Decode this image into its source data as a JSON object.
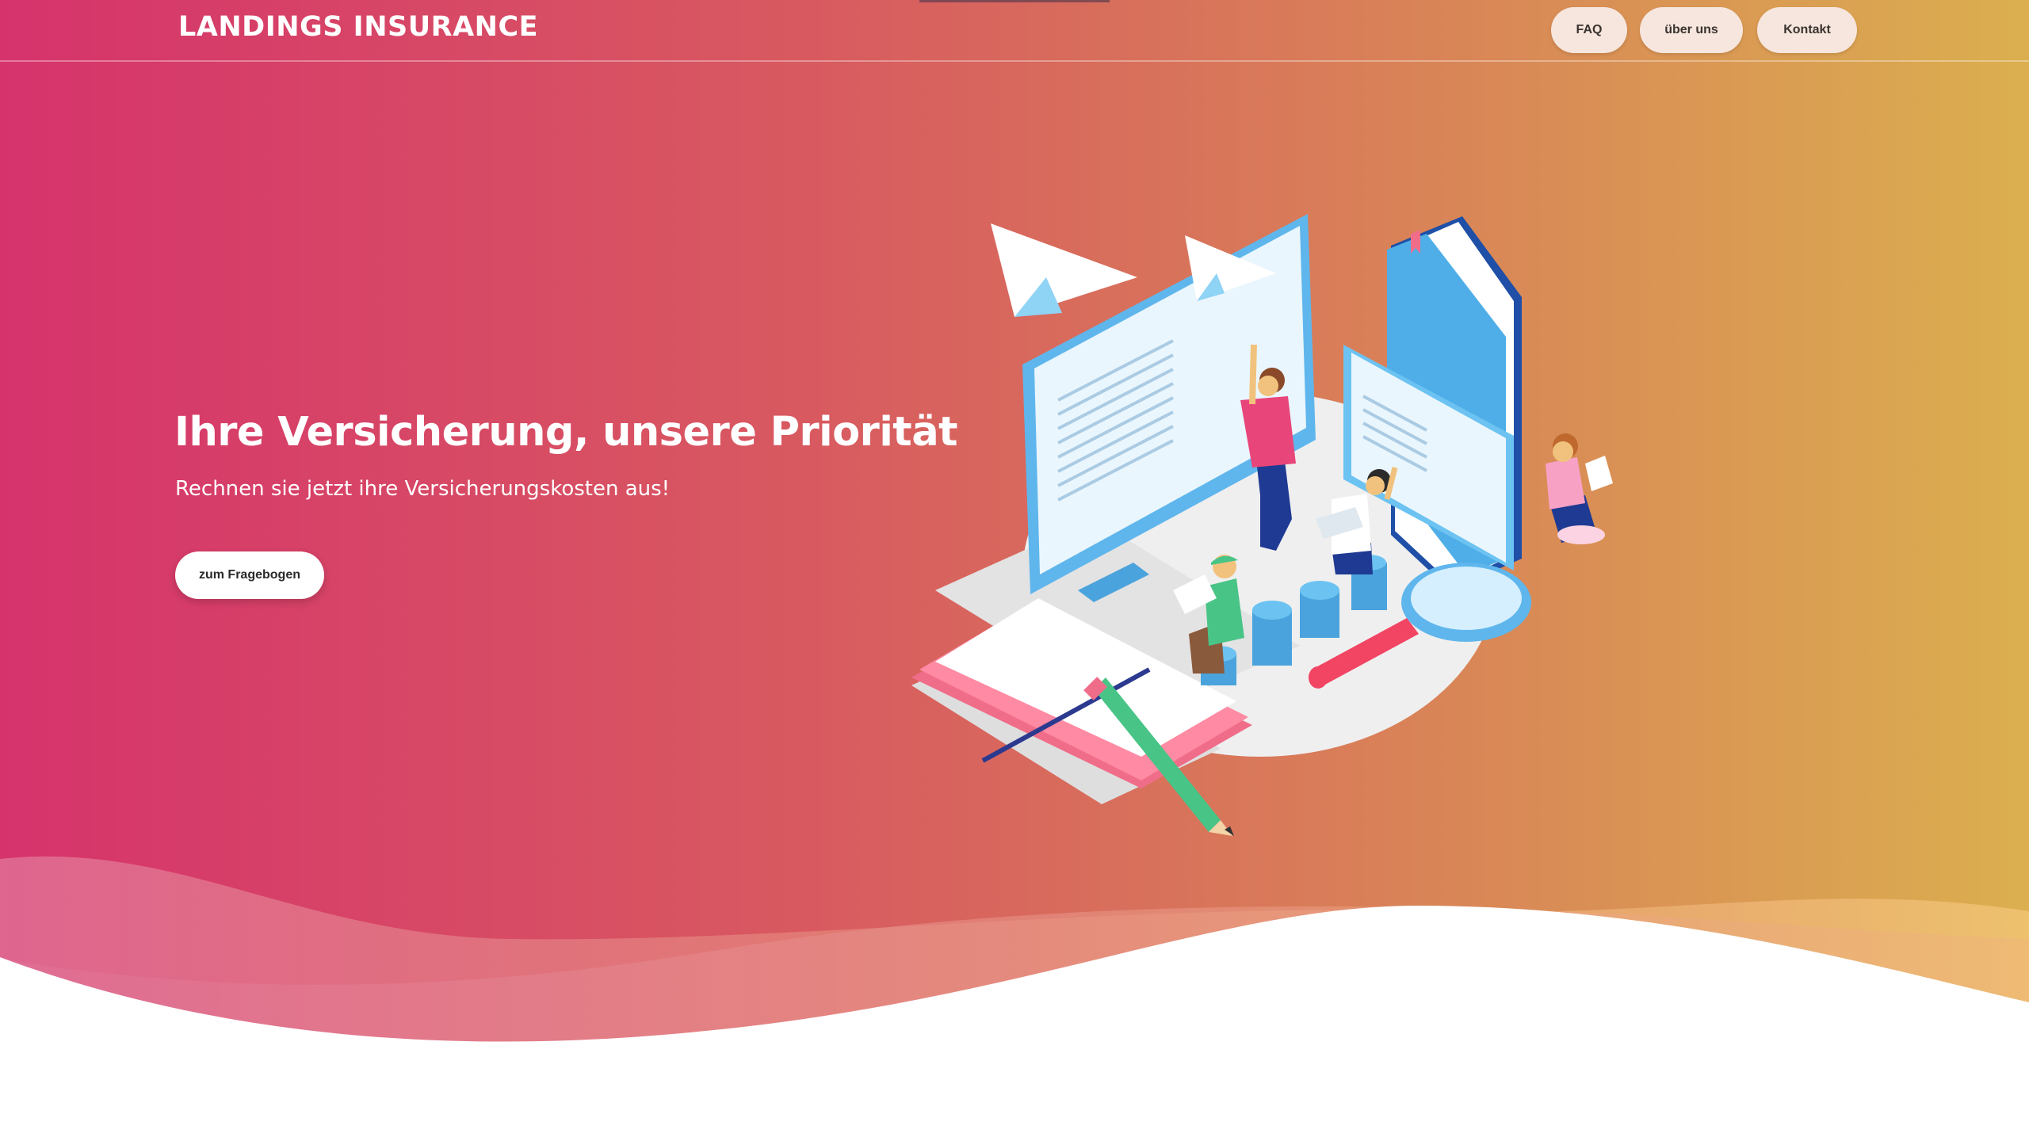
{
  "header": {
    "brand": "LANDINGS INSURANCE",
    "nav": [
      {
        "label": "FAQ"
      },
      {
        "label": "über uns"
      },
      {
        "label": "Kontakt"
      }
    ]
  },
  "hero": {
    "title": "Ihre Versicherung, unsere Priorität",
    "subtitle": "Rechnen sie jetzt ihre Versicherungskosten aus!",
    "cta_label": "zum Fragebogen"
  },
  "colors": {
    "gradient_start": "#d6336c",
    "gradient_end": "#dbaf4f",
    "nav_button_bg": "#f6e6dd",
    "cta_bg": "#ffffff"
  },
  "icons": {
    "hero_illustration": "isometric-learning-illustration"
  }
}
